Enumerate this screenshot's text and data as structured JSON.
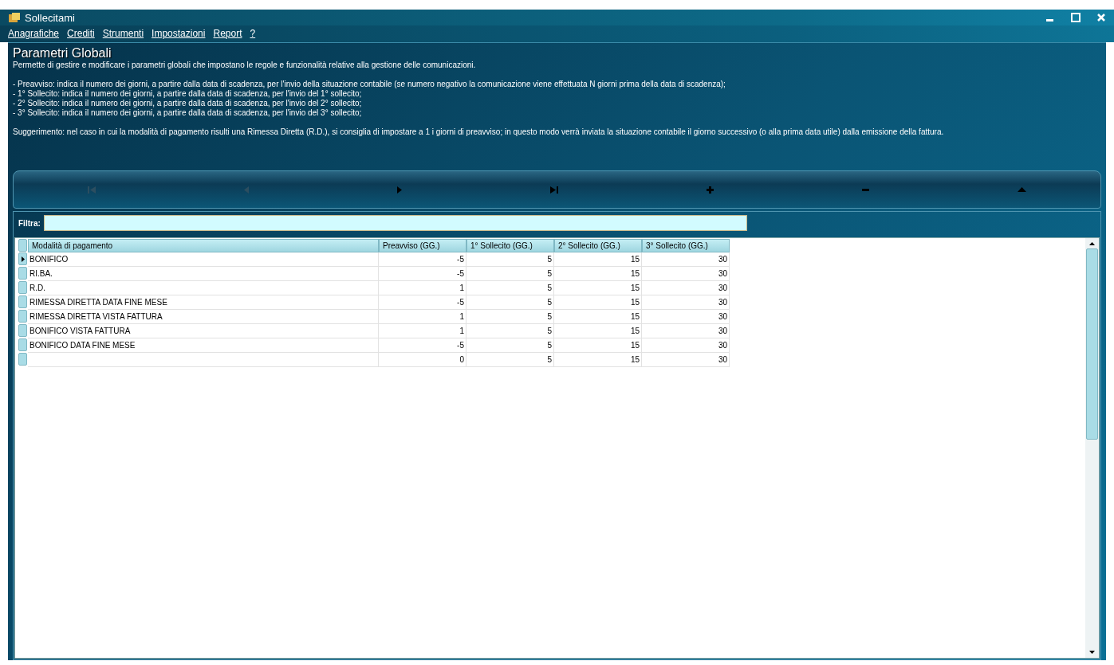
{
  "window": {
    "title": "Sollecitami"
  },
  "menu": [
    {
      "label": "Anagrafiche"
    },
    {
      "label": "Crediti"
    },
    {
      "label": "Strumenti"
    },
    {
      "label": "Impostazioni"
    },
    {
      "label": "Report"
    },
    {
      "label": "?"
    }
  ],
  "panel": {
    "title": "Parametri Globali",
    "description": "Permette di gestire e modificare i parametri globali che impostano le regole e funzionalità relative alla gestione delle comunicazioni.",
    "notes": [
      "- Preavviso: indica il numero dei giorni, a partire dalla data di scadenza, per l'invio della situazione contabile (se numero negativo la comunicazione viene effettuata N giorni prima della data di scadenza);",
      "- 1° Sollecito: indica il numero dei giorni, a partire dalla data di scadenza, per l'invio del 1° sollecito;",
      "- 2° Sollecito: indica il numero dei giorni, a partire dalla data di scadenza, per l'invio del 2° sollecito;",
      "- 3° Sollecito: indica il numero dei giorni, a partire dalla data di scadenza, per l'invio del 3° sollecito;"
    ],
    "hint": "Suggerimento: nel caso in cui la modalità di pagamento risulti una Rimessa Diretta (R.D.), si consiglia di impostare a 1 i giorni di preavviso; in questo modo verrà inviata la situazione contabile il giorno successivo (o alla prima data utile) dalla emissione della fattura."
  },
  "toolbar": [
    {
      "kind": "first",
      "disabled": true
    },
    {
      "kind": "prev",
      "disabled": true
    },
    {
      "kind": "next",
      "disabled": false
    },
    {
      "kind": "last",
      "disabled": false
    },
    {
      "kind": "add",
      "disabled": false
    },
    {
      "kind": "remove",
      "disabled": false
    },
    {
      "kind": "up",
      "disabled": false
    }
  ],
  "filter": {
    "label": "Filtra:"
  },
  "table": {
    "columns": [
      "Modalità di pagamento",
      "Preavviso (GG.)",
      "1° Sollecito (GG.)",
      "2° Sollecito (GG.)",
      "3° Sollecito (GG.)"
    ],
    "rows": [
      {
        "selected": true,
        "cells": [
          "BONIFICO",
          "-5",
          "5",
          "15",
          "30"
        ]
      },
      {
        "selected": false,
        "cells": [
          "RI.BA.",
          "-5",
          "5",
          "15",
          "30"
        ]
      },
      {
        "selected": false,
        "cells": [
          "R.D.",
          "1",
          "5",
          "15",
          "30"
        ]
      },
      {
        "selected": false,
        "cells": [
          "RIMESSA DIRETTA DATA FINE MESE",
          "-5",
          "5",
          "15",
          "30"
        ]
      },
      {
        "selected": false,
        "cells": [
          "RIMESSA DIRETTA VISTA FATTURA",
          "1",
          "5",
          "15",
          "30"
        ]
      },
      {
        "selected": false,
        "cells": [
          "BONIFICO VISTA FATTURA",
          "1",
          "5",
          "15",
          "30"
        ]
      },
      {
        "selected": false,
        "cells": [
          "BONIFICO DATA FINE MESE",
          "-5",
          "5",
          "15",
          "30"
        ]
      },
      {
        "selected": false,
        "cells": [
          null,
          "0",
          "5",
          "15",
          "30"
        ]
      }
    ]
  }
}
